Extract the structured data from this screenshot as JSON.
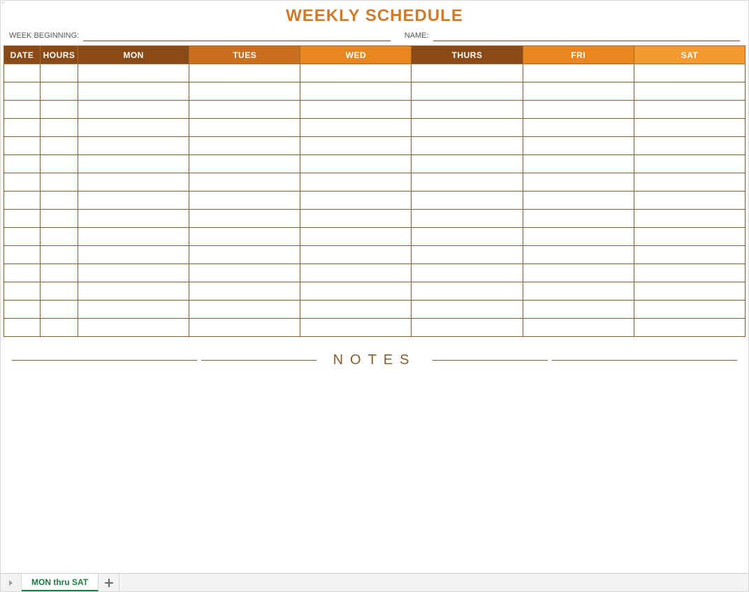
{
  "title": "WEEKLY SCHEDULE",
  "meta": {
    "week_beginning_label": "WEEK BEGINNING:",
    "week_beginning_value": "",
    "name_label": "NAME:",
    "name_value": ""
  },
  "headers": {
    "date": "DATE",
    "hours": "HOURS",
    "mon": "MON",
    "tues": "TUES",
    "wed": "WED",
    "thurs": "THURS",
    "fri": "FRI",
    "sat": "SAT"
  },
  "header_colors": {
    "date": "hdr-brown",
    "hours": "hdr-brown",
    "mon": "hdr-brown",
    "tues": "hdr-orange-dark",
    "wed": "hdr-orange",
    "thurs": "hdr-brown",
    "fri": "hdr-orange",
    "sat": "hdr-orange-light"
  },
  "row_count": 15,
  "notes_label": "NOTES",
  "sheet_tabs": {
    "active": "MON thru SAT"
  },
  "colors": {
    "accent_orange": "#d07a2a",
    "header_brown": "#8a4a16",
    "header_orange_dark": "#c96f1d",
    "header_orange": "#e8861f",
    "header_orange_light": "#f2992f",
    "grid_border": "#8a5a2b",
    "tab_active_green": "#1d7a46"
  }
}
